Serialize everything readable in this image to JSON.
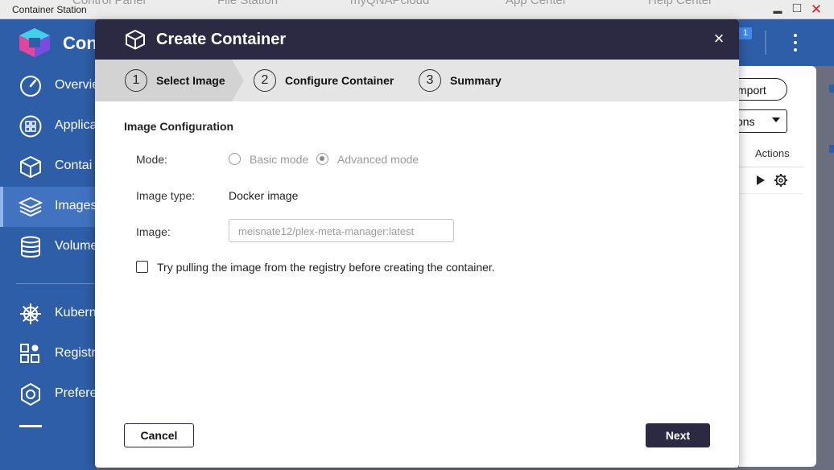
{
  "window": {
    "title": "Container Station",
    "background_tabs": [
      "Control Panel",
      "File Station",
      "myQNAPcloud",
      "App Center",
      "Help Center"
    ],
    "minimize": "▬",
    "maximize": "□",
    "close": "✕"
  },
  "sidebar": {
    "app_name": "Con",
    "items": [
      {
        "label": "Overvie",
        "icon": "gauge-icon"
      },
      {
        "label": "Applica",
        "icon": "apps-grid-icon"
      },
      {
        "label": "Contai",
        "icon": "cube-icon"
      },
      {
        "label": "Images",
        "icon": "layers-icon",
        "active": true
      },
      {
        "label": "Volume",
        "icon": "database-icon"
      },
      {
        "label": "Kubern",
        "icon": "helm-icon"
      },
      {
        "label": "Registr",
        "icon": "registry-grid-icon"
      },
      {
        "label": "Prefere",
        "icon": "gear-icon"
      }
    ]
  },
  "background": {
    "import_label": "mport",
    "select_label": "ons",
    "actions_header": "Actions",
    "badge": "1"
  },
  "modal": {
    "title": "Create Container",
    "close": "×",
    "steps": [
      {
        "number": "1",
        "label": "Select Image",
        "active": true
      },
      {
        "number": "2",
        "label": "Configure Container"
      },
      {
        "number": "3",
        "label": "Summary"
      }
    ],
    "section_title": "Image Configuration",
    "mode": {
      "label": "Mode:",
      "options": [
        {
          "label": "Basic mode",
          "selected": false
        },
        {
          "label": "Advanced mode",
          "selected": true
        }
      ]
    },
    "image_type": {
      "label": "Image type:",
      "value": "Docker image"
    },
    "image": {
      "label": "Image:",
      "value": "meisnate12/plex-meta-manager:latest"
    },
    "pull_checkbox": {
      "label": "Try pulling the image from the registry before creating the container.",
      "checked": false
    },
    "cancel_label": "Cancel",
    "next_label": "Next"
  },
  "colors": {
    "sidebar_bg": "#2f5ea8",
    "modal_header_bg": "#2b2a42",
    "close_button": "#d42020"
  }
}
